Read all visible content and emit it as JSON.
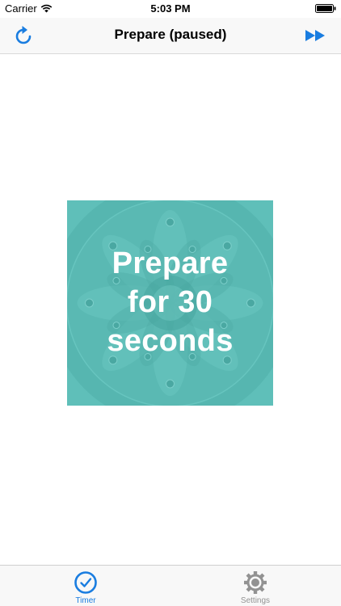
{
  "status_bar": {
    "carrier": "Carrier",
    "time": "5:03 PM"
  },
  "nav": {
    "title": "Prepare (paused)",
    "left_icon": "restart-icon",
    "right_icon": "fast-forward-icon"
  },
  "card": {
    "lines": [
      "Prepare",
      "for 30",
      "seconds"
    ],
    "background_color": "#5fbfb9"
  },
  "tabs": [
    {
      "label": "Timer",
      "icon": "clock-icon",
      "selected": true,
      "color": "#1a7de0"
    },
    {
      "label": "Settings",
      "icon": "gear-icon",
      "selected": false,
      "color": "#929292"
    }
  ],
  "colors": {
    "accent": "#1a7de0",
    "inactive": "#929292"
  }
}
